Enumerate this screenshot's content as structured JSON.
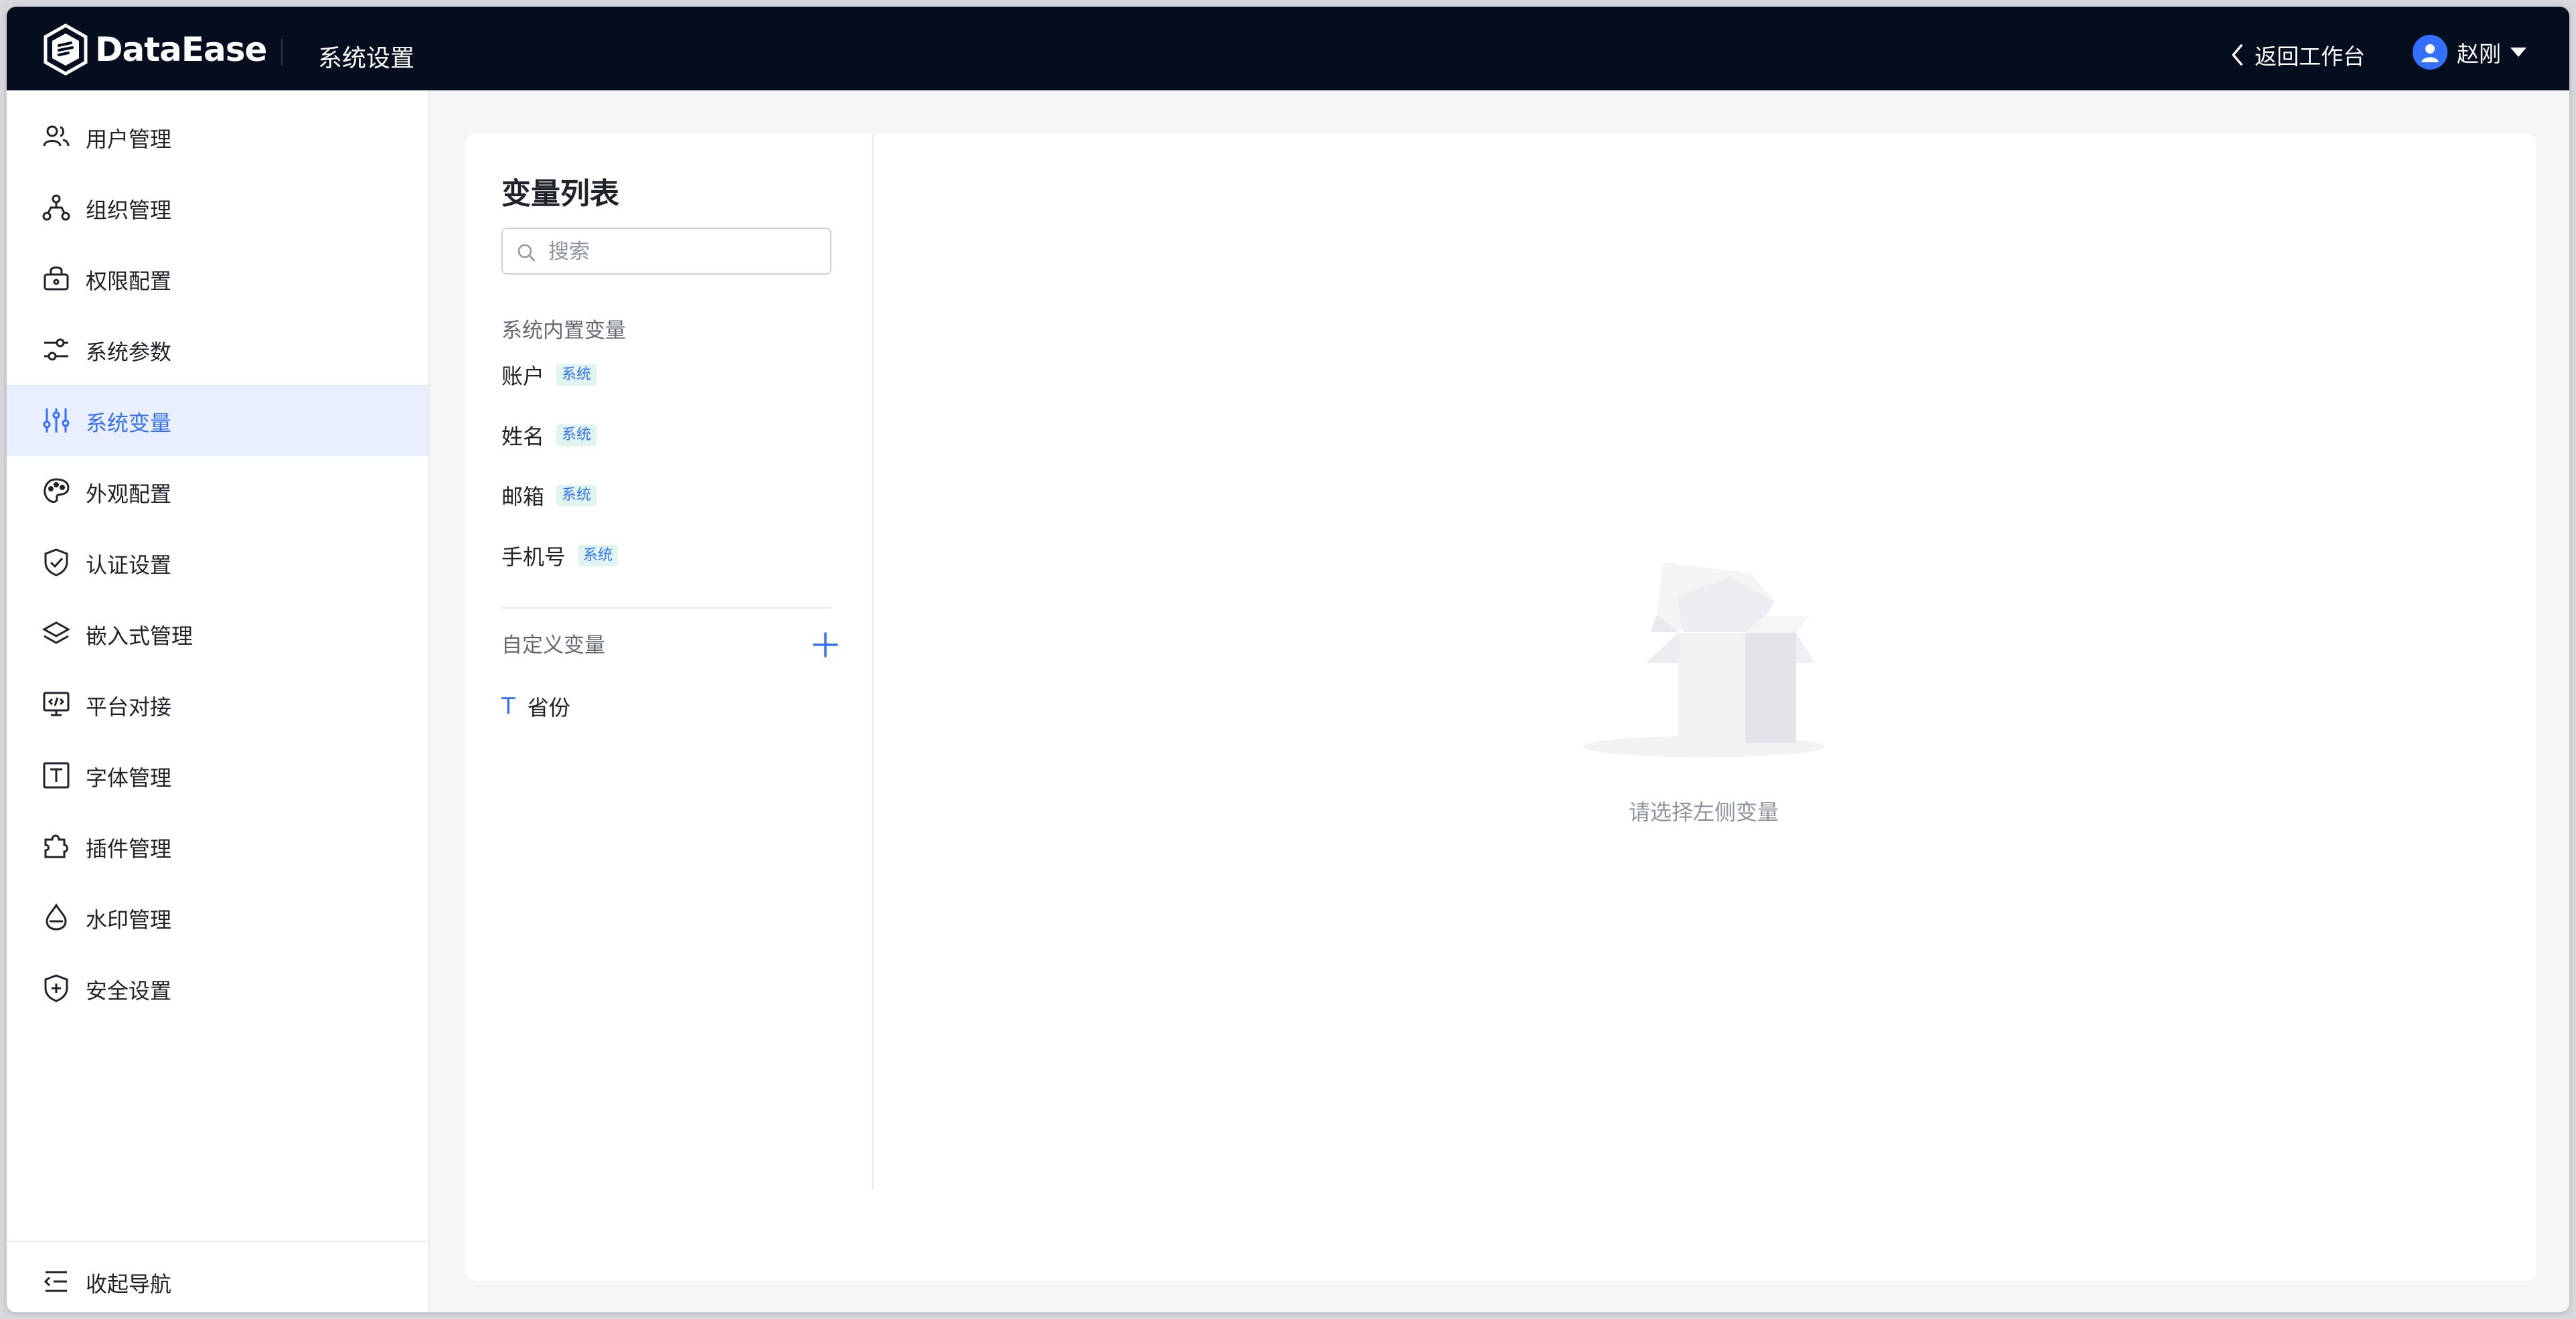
{
  "header": {
    "logo_text": "DataEase",
    "title": "系统设置",
    "back_label": "返回工作台",
    "user_name": "赵刚"
  },
  "sidebar": {
    "items": [
      {
        "label": "用户管理",
        "icon": "users-icon"
      },
      {
        "label": "组织管理",
        "icon": "org-tree-icon"
      },
      {
        "label": "权限配置",
        "icon": "permission-icon"
      },
      {
        "label": "系统参数",
        "icon": "sliders-icon"
      },
      {
        "label": "系统变量",
        "icon": "variable-icon",
        "active": true
      },
      {
        "label": "外观配置",
        "icon": "palette-icon"
      },
      {
        "label": "认证设置",
        "icon": "shield-check-icon"
      },
      {
        "label": "嵌入式管理",
        "icon": "layers-icon"
      },
      {
        "label": "平台对接",
        "icon": "monitor-code-icon"
      },
      {
        "label": "字体管理",
        "icon": "font-icon"
      },
      {
        "label": "插件管理",
        "icon": "puzzle-icon"
      },
      {
        "label": "水印管理",
        "icon": "drop-icon"
      },
      {
        "label": "安全设置",
        "icon": "shield-plus-icon"
      }
    ],
    "collapse_label": "收起导航"
  },
  "variables": {
    "title": "变量列表",
    "search_placeholder": "搜索",
    "builtin_group": "系统内置变量",
    "builtin_items": [
      {
        "name": "账户",
        "tag": "系统"
      },
      {
        "name": "姓名",
        "tag": "系统"
      },
      {
        "name": "邮箱",
        "tag": "系统"
      },
      {
        "name": "手机号",
        "tag": "系统"
      }
    ],
    "custom_group": "自定义变量",
    "custom_items": [
      {
        "type_icon": "T",
        "name": "省份"
      }
    ]
  },
  "empty": {
    "text": "请选择左侧变量"
  },
  "colors": {
    "accent": "#3370ff",
    "topbar": "#050e1f",
    "active_bg": "#e9effe"
  }
}
